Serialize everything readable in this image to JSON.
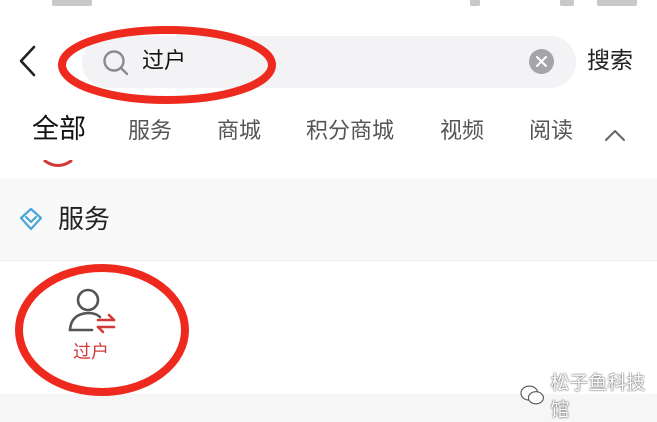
{
  "header": {
    "search": {
      "query": "过户"
    },
    "search_action_label": "搜索"
  },
  "tabs": [
    {
      "label": "全部",
      "active": true
    },
    {
      "label": "服务",
      "active": false
    },
    {
      "label": "商城",
      "active": false
    },
    {
      "label": "积分商城",
      "active": false
    },
    {
      "label": "视频",
      "active": false
    },
    {
      "label": "阅读",
      "active": false
    }
  ],
  "section": {
    "title": "服务"
  },
  "services": [
    {
      "label": "过户",
      "icon": "user-transfer-icon"
    }
  ],
  "watermark": {
    "text": "松子鱼科技馆"
  },
  "colors": {
    "accent": "#d23a3a",
    "annotation": "#ee2a1e",
    "section_icon": "#4aa6d8",
    "search_bg": "#f3f3f5"
  }
}
